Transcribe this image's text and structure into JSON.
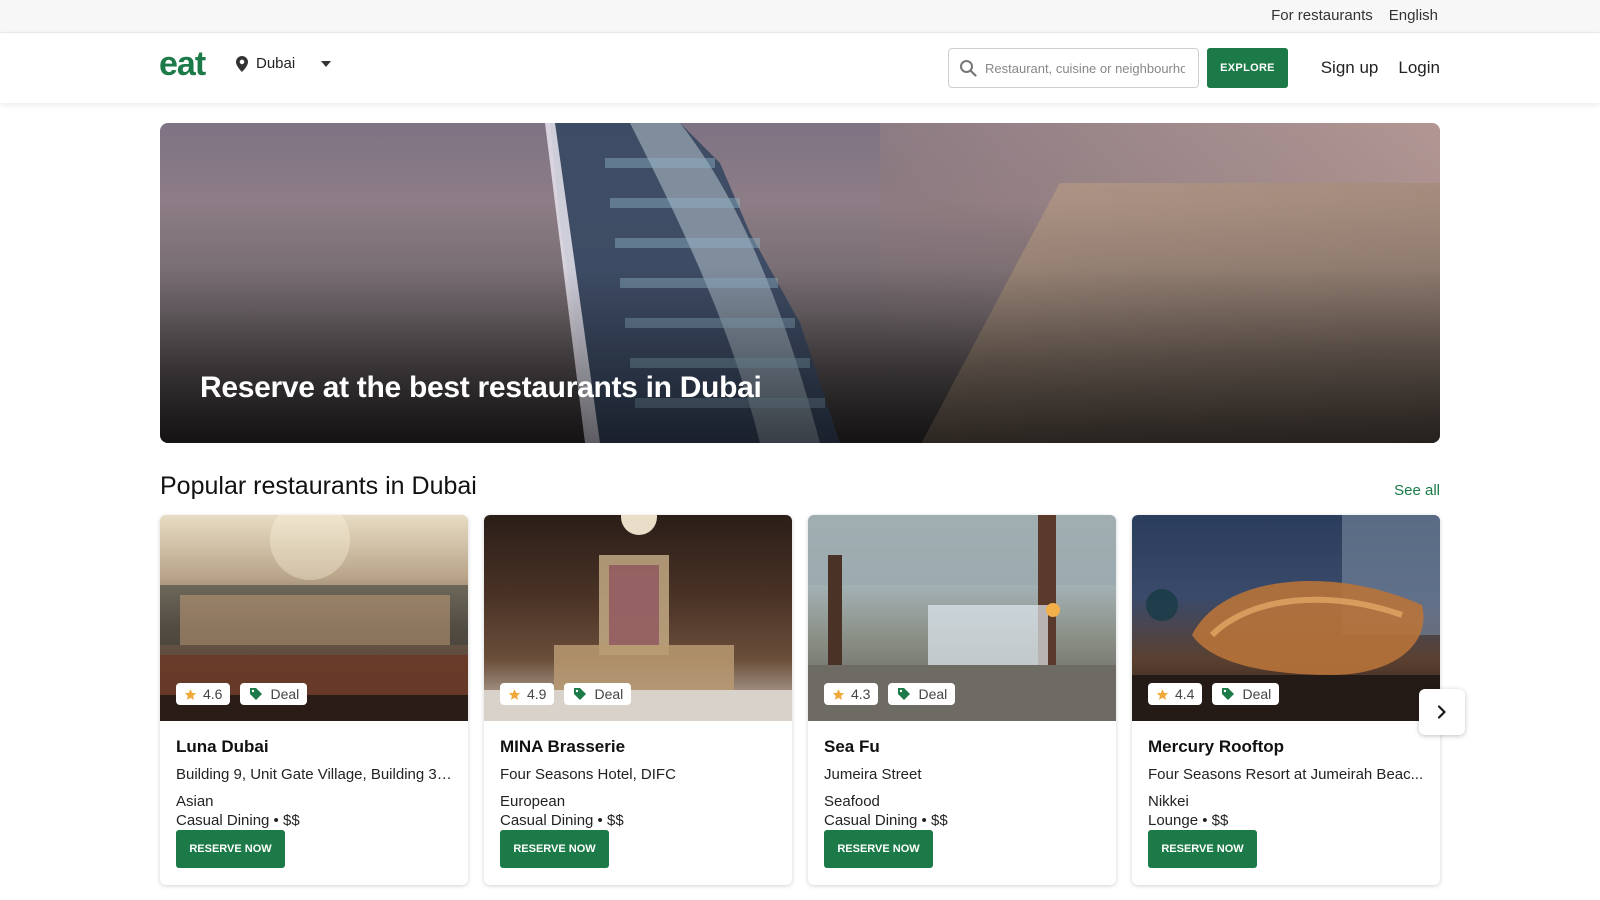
{
  "topbar": {
    "for_restaurants": "For restaurants",
    "language": "English"
  },
  "header": {
    "logo": "eat",
    "location": "Dubai",
    "search_placeholder": "Restaurant, cuisine or neighbourhood",
    "explore_label": "EXPLORE",
    "signup_label": "Sign up",
    "login_label": "Login"
  },
  "hero": {
    "title": "Reserve at the best restaurants in Dubai"
  },
  "section": {
    "title": "Popular restaurants in Dubai",
    "see_all": "See all"
  },
  "colors": {
    "brand": "#1b7a47",
    "star": "#f0a83a"
  },
  "restaurants": [
    {
      "name": "Luna Dubai",
      "address": "Building 9, Unit Gate Village, Building 3 ...",
      "cuisine": "Asian",
      "type": "Casual Dining • $$",
      "rating": "4.6",
      "deal": "Deal",
      "reserve": "RESERVE NOW"
    },
    {
      "name": "MINA Brasserie",
      "address": "Four Seasons Hotel, DIFC",
      "cuisine": "European",
      "type": "Casual Dining • $$",
      "rating": "4.9",
      "deal": "Deal",
      "reserve": "RESERVE NOW"
    },
    {
      "name": "Sea Fu",
      "address": "Jumeira Street",
      "cuisine": "Seafood",
      "type": "Casual Dining • $$",
      "rating": "4.3",
      "deal": "Deal",
      "reserve": "RESERVE NOW"
    },
    {
      "name": "Mercury Rooftop",
      "address": "Four Seasons Resort at Jumeirah Beac...",
      "cuisine": "Nikkei",
      "type": "Lounge • $$",
      "rating": "4.4",
      "deal": "Deal",
      "reserve": "RESERVE NOW"
    }
  ]
}
